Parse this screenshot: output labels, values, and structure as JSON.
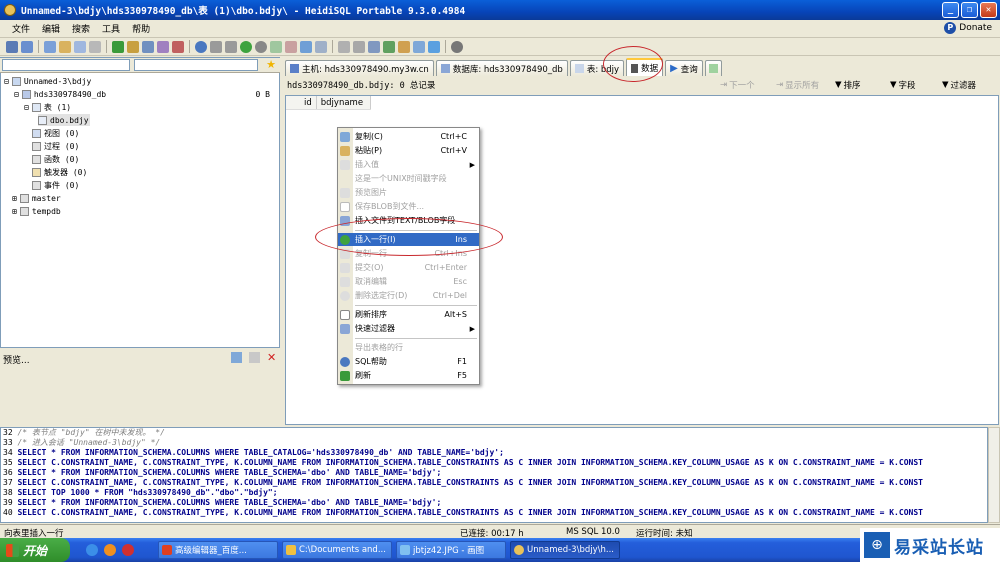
{
  "window": {
    "title": "Unnamed-3\\bdjy\\hds330978490_db\\表 (1)\\dbo.bdjy\\ - HeidiSQL Portable 9.3.0.4984"
  },
  "menu": {
    "items": [
      "文件",
      "编辑",
      "搜索",
      "工具",
      "帮助"
    ],
    "donate": "Donate"
  },
  "tree": {
    "root": "Unnamed-3\\bdjy",
    "db": "hds330978490_db",
    "db_size": "0 B",
    "tables": "表 (1)",
    "table_item": "dbo.bdjy",
    "views": "视图 (0)",
    "procs": "过程 (0)",
    "funcs": "函数 (0)",
    "triggers": "触发器 (0)",
    "events": "事件 (0)",
    "master": "master",
    "tempdb": "tempdb"
  },
  "preview": {
    "label": "预览..."
  },
  "tabs": [
    {
      "label": "主机: hds330978490.my3w.cn"
    },
    {
      "label": "数据库: hds330978490_db"
    },
    {
      "label": "表: bdjy"
    },
    {
      "label": "数据"
    },
    {
      "label": "查询"
    }
  ],
  "data_header": {
    "info": "hds330978490_db.bdjy: 0 总记录",
    "next": "下一个",
    "show_all": "显示所有",
    "sort": "排序",
    "columns": "字段",
    "filter": "过滤器"
  },
  "grid": {
    "columns": [
      "id",
      "bdjyname"
    ]
  },
  "context_menu": [
    {
      "label": "复制(C)",
      "key": "Ctrl+C"
    },
    {
      "label": "粘贴(P)",
      "key": "Ctrl+V"
    },
    {
      "label": "插入值",
      "key": ""
    },
    {
      "label": "这是一个UNIX时间戳字段",
      "key": ""
    },
    {
      "label": "预览图片",
      "key": ""
    },
    {
      "label": "保存BLOB到文件...",
      "key": ""
    },
    {
      "label": "插入文件到TEXT/BLOB字段",
      "key": ""
    },
    {
      "label": "插入一行(I)",
      "key": "Ins"
    },
    {
      "label": "复制一行",
      "key": "Ctrl+Ins"
    },
    {
      "label": "提交(O)",
      "key": "Ctrl+Enter"
    },
    {
      "label": "取消编辑",
      "key": "Esc"
    },
    {
      "label": "删除选定行(D)",
      "key": "Ctrl+Del"
    },
    {
      "label": "刷新排序",
      "key": "Alt+S"
    },
    {
      "label": "快速过滤器",
      "key": ""
    },
    {
      "label": "导出表格的行",
      "key": ""
    },
    {
      "label": "SQL帮助",
      "key": "F1"
    },
    {
      "label": "刷新",
      "key": "F5"
    }
  ],
  "sql_log": [
    {
      "n": "32",
      "text": "/* 表节点 \"bdjy\" 在树中未发现。 */"
    },
    {
      "n": "33",
      "text": "/* 进入会话 \"Unnamed-3\\bdjy\" */"
    },
    {
      "n": "34",
      "text": "SELECT * FROM INFORMATION_SCHEMA.COLUMNS WHERE TABLE_CATALOG='hds330978490_db' AND TABLE_NAME='bdjy';"
    },
    {
      "n": "35",
      "text": "SELECT C.CONSTRAINT_NAME, C.CONSTRAINT_TYPE, K.COLUMN_NAME FROM INFORMATION_SCHEMA.TABLE_CONSTRAINTS AS C INNER JOIN INFORMATION_SCHEMA.KEY_COLUMN_USAGE AS K ON C.CONSTRAINT_NAME = K.CONST"
    },
    {
      "n": "36",
      "text": "SELECT * FROM INFORMATION_SCHEMA.COLUMNS WHERE TABLE_SCHEMA='dbo' AND TABLE_NAME='bdjy';"
    },
    {
      "n": "37",
      "text": "SELECT C.CONSTRAINT_NAME, C.CONSTRAINT_TYPE, K.COLUMN_NAME FROM INFORMATION_SCHEMA.TABLE_CONSTRAINTS AS C INNER JOIN INFORMATION_SCHEMA.KEY_COLUMN_USAGE AS K ON C.CONSTRAINT_NAME = K.CONST"
    },
    {
      "n": "38",
      "text": "SELECT TOP 1000 * FROM \"hds330978490_db\".\"dbo\".\"bdjy\";"
    },
    {
      "n": "39",
      "text": "SELECT * FROM INFORMATION_SCHEMA.COLUMNS WHERE TABLE_SCHEMA='dbo' AND TABLE_NAME='bdjy';"
    },
    {
      "n": "40",
      "text": "SELECT C.CONSTRAINT_NAME, C.CONSTRAINT_TYPE, K.COLUMN_NAME FROM INFORMATION_SCHEMA.TABLE_CONSTRAINTS AS C INNER JOIN INFORMATION_SCHEMA.KEY_COLUMN_USAGE AS K ON C.CONSTRAINT_NAME = K.CONST"
    }
  ],
  "status": {
    "hint": "向表里插入一行",
    "connected": "已连接: 00:17 h",
    "server": "MS SQL 10.0",
    "runtime": "运行时间: 未知"
  },
  "taskbar": {
    "start": "开始",
    "tasks": [
      "高级编辑器_百度...",
      "C:\\Documents and...",
      "jbtjz42.JPG - 画图",
      "Unnamed-3\\bdjy\\h..."
    ]
  },
  "watermark": {
    "logo": "⊕",
    "text": "易采站长站"
  },
  "colors": {
    "accent": "#316ac5",
    "annotation": "#c8282d",
    "titlebar": "#0a5fd8"
  }
}
